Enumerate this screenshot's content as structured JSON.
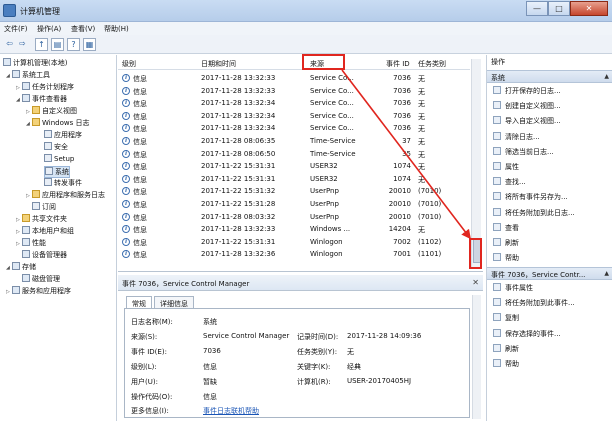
{
  "window": {
    "title": "计算机管理",
    "buttons": [
      "—",
      "□",
      "✕"
    ]
  },
  "menu": [
    "文件(F)",
    "操作(A)",
    "查看(V)",
    "帮助(H)"
  ],
  "toolbar_icons": [
    "back-icon",
    "forward-icon",
    "up-folder-icon",
    "show-tree-icon",
    "help-icon",
    "properties-icon"
  ],
  "tree": [
    {
      "label": "计算机管理(本地)",
      "level": 0
    },
    {
      "label": "系统工具",
      "level": 1
    },
    {
      "label": "任务计划程序",
      "level": 2
    },
    {
      "label": "事件查看器",
      "level": 2
    },
    {
      "label": "自定义视图",
      "level": 3
    },
    {
      "label": "Windows 日志",
      "level": 3
    },
    {
      "label": "应用程序",
      "level": 4
    },
    {
      "label": "安全",
      "level": 4
    },
    {
      "label": "Setup",
      "level": 4
    },
    {
      "label": "系统",
      "level": 4
    },
    {
      "label": "转发事件",
      "level": 4
    },
    {
      "label": "应用程序和服务日志",
      "level": 3
    },
    {
      "label": "订阅",
      "level": 3
    },
    {
      "label": "共享文件夹",
      "level": 2
    },
    {
      "label": "本地用户和组",
      "level": 2
    },
    {
      "label": "性能",
      "level": 2
    },
    {
      "label": "设备管理器",
      "level": 2
    },
    {
      "label": "存储",
      "level": 1
    },
    {
      "label": "磁盘管理",
      "level": 2
    },
    {
      "label": "服务和应用程序",
      "level": 1
    }
  ],
  "events": {
    "columns": [
      "级别",
      "日期和时间",
      "来源",
      "事件 ID",
      "任务类别"
    ],
    "rows": [
      [
        "信息",
        "2017-11-28 13:32:33",
        "Service Co...",
        "7036",
        "无"
      ],
      [
        "信息",
        "2017-11-28 13:32:33",
        "Service Co...",
        "7036",
        "无"
      ],
      [
        "信息",
        "2017-11-28 13:32:34",
        "Service Co...",
        "7036",
        "无"
      ],
      [
        "信息",
        "2017-11-28 13:32:34",
        "Service Co...",
        "7036",
        "无"
      ],
      [
        "信息",
        "2017-11-28 13:32:34",
        "Service Co...",
        "7036",
        "无"
      ],
      [
        "信息",
        "2017-11-28 08:06:35",
        "Time-Service",
        "37",
        "无"
      ],
      [
        "信息",
        "2017-11-28 08:06:50",
        "Time-Service",
        "35",
        "无"
      ],
      [
        "信息",
        "2017-11-22 15:31:31",
        "USER32",
        "1074",
        "无"
      ],
      [
        "信息",
        "2017-11-22 15:31:31",
        "USER32",
        "1074",
        "无"
      ],
      [
        "信息",
        "2017-11-22 15:31:32",
        "UserPnp",
        "20010",
        "(7010)"
      ],
      [
        "信息",
        "2017-11-22 15:31:28",
        "UserPnp",
        "20010",
        "(7010)"
      ],
      [
        "信息",
        "2017-11-28 08:03:32",
        "UserPnp",
        "20010",
        "(7010)"
      ],
      [
        "信息",
        "2017-11-28 13:32:33",
        "Windows ...",
        "14204",
        "无"
      ],
      [
        "信息",
        "2017-11-22 15:31:31",
        "Winlogon",
        "7002",
        "(1102)"
      ],
      [
        "信息",
        "2017-11-28 13:32:36",
        "Winlogon",
        "7001",
        "(1101)"
      ]
    ]
  },
  "detail": {
    "title": "事件 7036，Service Control Manager",
    "tabs": [
      "常规",
      "详细信息"
    ],
    "fields": {
      "log_name_label": "日志名称(M):",
      "log_name": "系统",
      "source_label": "来源(S):",
      "source": "Service Control Manager",
      "logged_label": "记录时间(D):",
      "logged": "2017-11-28 14:09:36",
      "event_id_label": "事件 ID(E):",
      "event_id": "7036",
      "task_label": "任务类别(Y):",
      "task": "无",
      "level_label": "级别(L):",
      "level": "信息",
      "keywords_label": "关键字(K):",
      "keywords": "经典",
      "user_label": "用户(U):",
      "user": "暂缺",
      "computer_label": "计算机(R):",
      "computer": "USER-20170405HJ",
      "opcode_label": "操作代码(O):",
      "opcode": "信息",
      "more_label": "更多信息(I):",
      "more_link": "事件日志联机帮助"
    }
  },
  "actions": {
    "header": "操作",
    "section1": "系统",
    "items1": [
      "打开保存的日志...",
      "创建自定义视图...",
      "导入自定义视图...",
      "清除日志...",
      "筛选当前日志...",
      "属性",
      "查找...",
      "将所有事件另存为...",
      "将任务附加到此日志...",
      "查看",
      "刷新",
      "帮助"
    ],
    "section2": "事件 7036，Service Contr...",
    "items2": [
      "事件属性",
      "将任务附加到此事件...",
      "复制",
      "保存选择的事件...",
      "刷新",
      "帮助"
    ]
  },
  "colors": {
    "highlight": "#e0261f",
    "accent": "#3e6fb0"
  }
}
